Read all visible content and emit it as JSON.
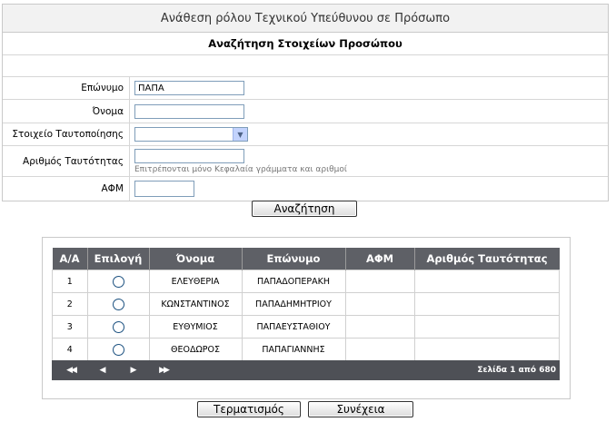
{
  "form": {
    "title": "Ανάθεση ρόλου Τεχνικού Υπεύθυνου σε Πρόσωπο",
    "subtitle": "Αναζήτηση Στοιχείων Προσώπου",
    "fields": {
      "surname_label": "Επώνυμο",
      "surname_value": "ΠΑΠΑ",
      "name_label": "Όνομα",
      "name_value": "",
      "id_type_label": "Στοιχείο Ταυτοποίησης",
      "id_type_value": "",
      "id_number_label": "Αριθμός Ταυτότητας",
      "id_number_value": "",
      "id_number_hint": "Επιτρέπονται μόνο Κεφαλαία γράμματα και αριθμοί",
      "afm_label": "ΑΦΜ",
      "afm_value": ""
    },
    "search_button": "Αναζήτηση"
  },
  "results": {
    "columns": [
      "Α/Α",
      "Επιλογή",
      "Όνομα",
      "Επώνυμο",
      "ΑΦΜ",
      "Αριθμός Ταυτότητας"
    ],
    "rows": [
      {
        "aa": "1",
        "name": "ΕΛΕΥΘΕΡΙΑ",
        "surname": "ΠΑΠΑΔΟΠΕΡΑΚΗ",
        "afm": "",
        "id": ""
      },
      {
        "aa": "2",
        "name": "ΚΩΝΣΤΑΝΤΙΝΟΣ",
        "surname": "ΠΑΠΑΔΗΜΗΤΡΙΟΥ",
        "afm": "",
        "id": ""
      },
      {
        "aa": "3",
        "name": "ΕΥΘΥΜΙΟΣ",
        "surname": "ΠΑΠΑΕΥΣΤΑΘΙΟΥ",
        "afm": "",
        "id": ""
      },
      {
        "aa": "4",
        "name": "ΘΕΟΔΩΡΟΣ",
        "surname": "ΠΑΠΑΓΙΑΝΝΗΣ",
        "afm": "",
        "id": ""
      }
    ],
    "pager": {
      "first": "◀◀",
      "prev": "◀",
      "next": "▶",
      "last": "▶▶",
      "page_info": "Σελίδα 1 από 680"
    }
  },
  "footer": {
    "terminate_button": "Τερματισμός",
    "continue_button": "Συνέχεια"
  }
}
